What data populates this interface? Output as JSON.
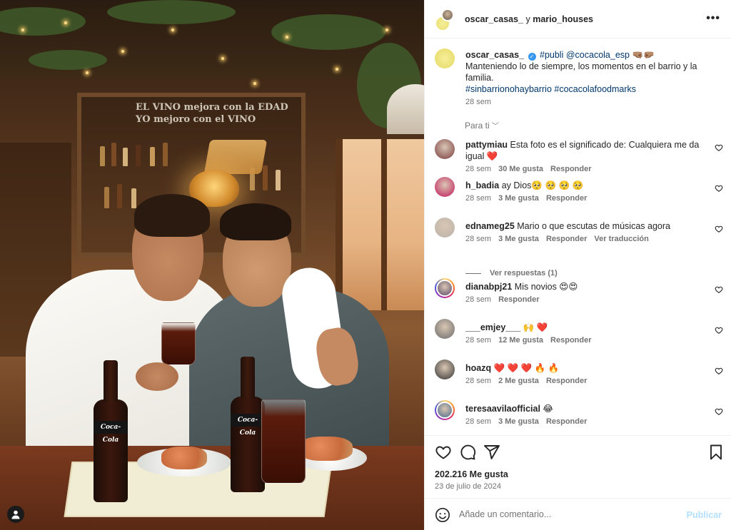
{
  "header": {
    "user1": "oscar_casas_",
    "separator": " y ",
    "user2": "mario_houses",
    "more_icon": "more-horizontal-icon"
  },
  "photo": {
    "shelf_sign_line1": "EL VINO mejora con la EDAD",
    "shelf_sign_line2": "YO mejoro con el VINO",
    "bottle_label": "Coca-Cola"
  },
  "caption": {
    "user": "oscar_casas_",
    "hashtag_publi": "#publi",
    "mention": "@cocacola_esp",
    "emojis": "🤜🏽🤛🏽",
    "text": "Manteniendo lo de siempre, los momentos en el barrio y la familia.",
    "hashtags": "#sinbarrionohaybarrio #cocacolafoodmarks",
    "time": "28 sem"
  },
  "for_you": "Para ti",
  "comments": [
    {
      "user": "pattymiau",
      "text": "Esta foto es el significado de: Cualquiera me da igual ❤️",
      "time": "28 sem",
      "likes": "30 Me gusta",
      "reply": "Responder",
      "translate": "",
      "avatar_color": "#7a3b3f"
    },
    {
      "user": "h_badia",
      "text": "ay Dios🥺 🥺 🥺 🥺",
      "time": "28 sem",
      "likes": "3 Me gusta",
      "reply": "Responder",
      "translate": "",
      "avatar_color": "#c2185b"
    },
    {
      "user": "ednameg25",
      "text": "Mario o que escutas de músicas agora",
      "time": "28 sem",
      "likes": "3 Me gusta",
      "reply": "Responder",
      "translate": "Ver traducción",
      "avatar_color": "#b9b3ab"
    },
    {
      "user": "dianabpj21",
      "text": "Mis novios 😍😍",
      "time": "28 sem",
      "likes": "",
      "reply": "Responder",
      "translate": "",
      "avatar_color": "#5b4a6a"
    },
    {
      "user": "___emjey___",
      "text": "🙌 ❤️",
      "time": "28 sem",
      "likes": "12 Me gusta",
      "reply": "Responder",
      "translate": "",
      "avatar_color": "#6a6a6a"
    },
    {
      "user": "hoazq",
      "text": "❤️ ❤️ ❤️ 🔥 🔥",
      "time": "28 sem",
      "likes": "2 Me gusta",
      "reply": "Responder",
      "translate": "",
      "avatar_color": "#333333"
    },
    {
      "user": "teresaavilaofficial",
      "text": "😂",
      "time": "28 sem",
      "likes": "3 Me gusta",
      "reply": "Responder",
      "translate": "",
      "avatar_color": "#4a6b8a"
    }
  ],
  "view_replies": "Ver respuestas (1)",
  "actions": {
    "likes": "202.216 Me gusta",
    "date": "23 de julio de 2024"
  },
  "comment_box": {
    "placeholder": "Añade un comentario...",
    "publish": "Publicar"
  },
  "colors": {
    "link": "#00376b",
    "verified": "#3897f0",
    "like_red": "#ed4956",
    "publish_disabled": "#b2dffc"
  }
}
